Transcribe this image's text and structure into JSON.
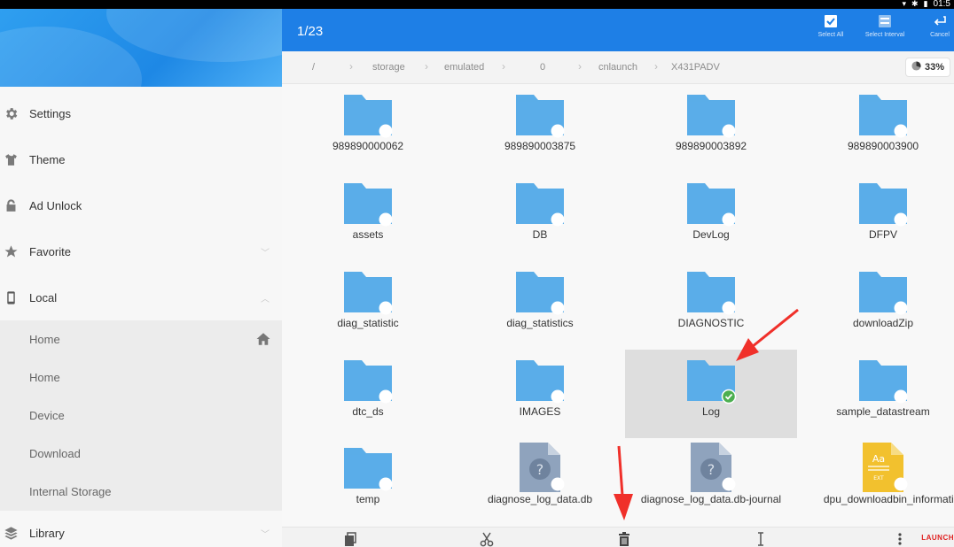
{
  "status": {
    "clock": "01:5"
  },
  "sidebar": {
    "items": [
      {
        "label": "Settings",
        "icon": "gear-icon"
      },
      {
        "label": "Theme",
        "icon": "shirt-icon"
      },
      {
        "label": "Ad Unlock",
        "icon": "lock-icon"
      },
      {
        "label": "Favorite",
        "icon": "star-icon"
      },
      {
        "label": "Local",
        "icon": "phone-icon"
      }
    ],
    "local_items": [
      {
        "label": "Home"
      },
      {
        "label": "Home"
      },
      {
        "label": "Device"
      },
      {
        "label": "Download"
      },
      {
        "label": "Internal Storage"
      }
    ],
    "library": {
      "label": "Library",
      "icon": "layers-icon"
    }
  },
  "appbar": {
    "count": "1/23",
    "select_all": "Select All",
    "select_interval": "Select Interval",
    "cancel": "Cancel"
  },
  "path": {
    "crumbs": [
      "/",
      "storage",
      "emulated",
      "0",
      "cnlaunch",
      "X431PADV"
    ],
    "usage": "33%"
  },
  "files": [
    {
      "name": "989890000062",
      "type": "folder"
    },
    {
      "name": "989890003875",
      "type": "folder"
    },
    {
      "name": "989890003892",
      "type": "folder"
    },
    {
      "name": "989890003900",
      "type": "folder"
    },
    {
      "name": "assets",
      "type": "folder"
    },
    {
      "name": "DB",
      "type": "folder"
    },
    {
      "name": "DevLog",
      "type": "folder"
    },
    {
      "name": "DFPV",
      "type": "folder"
    },
    {
      "name": "diag_statistic",
      "type": "folder"
    },
    {
      "name": "diag_statistics",
      "type": "folder"
    },
    {
      "name": "DIAGNOSTIC",
      "type": "folder"
    },
    {
      "name": "downloadZip",
      "type": "folder"
    },
    {
      "name": "dtc_ds",
      "type": "folder"
    },
    {
      "name": "IMAGES",
      "type": "folder"
    },
    {
      "name": "Log",
      "type": "folder",
      "selected": true
    },
    {
      "name": "sample_datastream",
      "type": "folder"
    },
    {
      "name": "temp",
      "type": "folder"
    },
    {
      "name": "diagnose_log_data.db",
      "type": "unknown"
    },
    {
      "name": "diagnose_log_data.db-journal",
      "type": "unknown"
    },
    {
      "name": "dpu_downloadbin_information.txt",
      "type": "text"
    }
  ],
  "text_icon_label": "EXT",
  "brand": "LAUNCH",
  "colors": {
    "accent": "#1e7fe6",
    "folder": "#5aade8",
    "check": "#4caf50",
    "arrow": "#f0302a"
  }
}
